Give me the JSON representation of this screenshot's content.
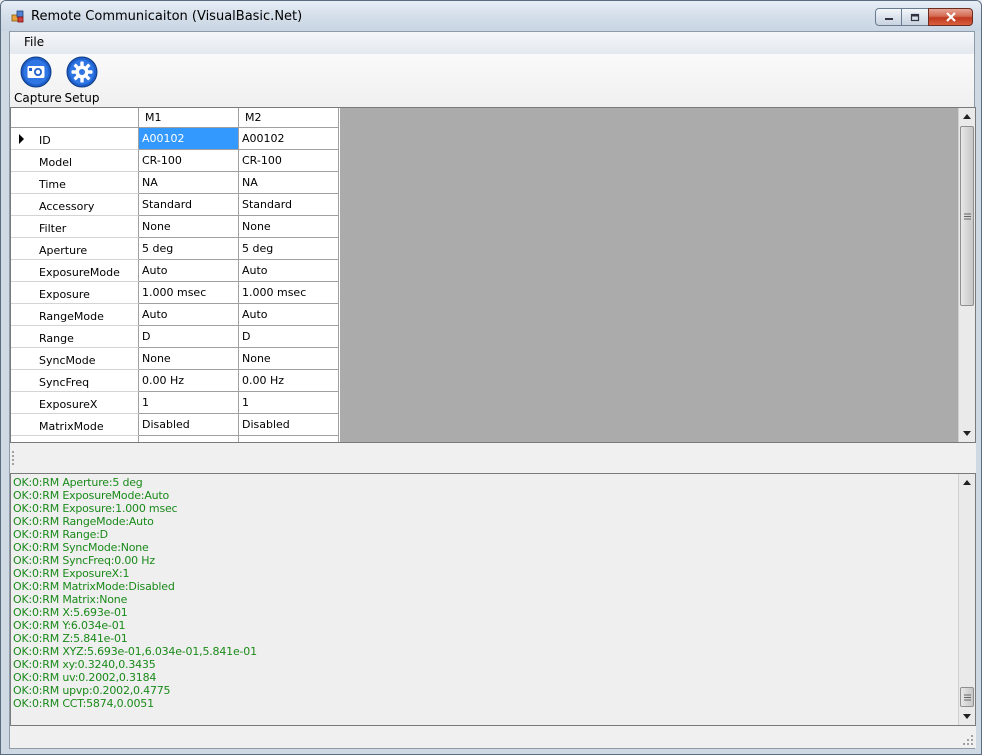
{
  "window": {
    "title": "Remote Communicaiton (VisualBasic.Net)"
  },
  "menu": {
    "items": [
      {
        "label": "File"
      }
    ]
  },
  "toolbar": {
    "capture_label": "Capture",
    "setup_label": "Setup"
  },
  "grid": {
    "columns": [
      "M1",
      "M2"
    ],
    "rows": [
      {
        "name": "ID",
        "values": [
          "A00102",
          "A00102"
        ]
      },
      {
        "name": "Model",
        "values": [
          "CR-100",
          "CR-100"
        ]
      },
      {
        "name": "Time",
        "values": [
          "NA",
          "NA"
        ]
      },
      {
        "name": "Accessory",
        "values": [
          "Standard",
          "Standard"
        ]
      },
      {
        "name": "Filter",
        "values": [
          "None",
          "None"
        ]
      },
      {
        "name": "Aperture",
        "values": [
          "5 deg",
          "5 deg"
        ]
      },
      {
        "name": "ExposureMode",
        "values": [
          "Auto",
          "Auto"
        ]
      },
      {
        "name": "Exposure",
        "values": [
          "1.000 msec",
          "1.000 msec"
        ]
      },
      {
        "name": "RangeMode",
        "values": [
          "Auto",
          "Auto"
        ]
      },
      {
        "name": "Range",
        "values": [
          "D",
          "D"
        ]
      },
      {
        "name": "SyncMode",
        "values": [
          "None",
          "None"
        ]
      },
      {
        "name": "SyncFreq",
        "values": [
          "0.00 Hz",
          "0.00 Hz"
        ]
      },
      {
        "name": "ExposureX",
        "values": [
          "1",
          "1"
        ]
      },
      {
        "name": "MatrixMode",
        "values": [
          "Disabled",
          "Disabled"
        ]
      }
    ]
  },
  "log": {
    "lines": [
      "OK:0:RM Aperture:5 deg",
      "OK:0:RM ExposureMode:Auto",
      "OK:0:RM Exposure:1.000 msec",
      "OK:0:RM RangeMode:Auto",
      "OK:0:RM Range:D",
      "OK:0:RM SyncMode:None",
      "OK:0:RM SyncFreq:0.00 Hz",
      "OK:0:RM ExposureX:1",
      "OK:0:RM MatrixMode:Disabled",
      "OK:0:RM Matrix:None",
      "OK:0:RM X:5.693e-01",
      "OK:0:RM Y:6.034e-01",
      "OK:0:RM Z:5.841e-01",
      "OK:0:RM XYZ:5.693e-01,6.034e-01,5.841e-01",
      "OK:0:RM xy:0.3240,0.3435",
      "OK:0:RM uv:0.2002,0.3184",
      "OK:0:RM upvp:0.2002,0.4775",
      "OK:0:RM CCT:5874,0.0051"
    ],
    "text_color": "#1a8a1a"
  },
  "icons": {
    "capture": "camera-icon",
    "setup": "gear-icon"
  }
}
